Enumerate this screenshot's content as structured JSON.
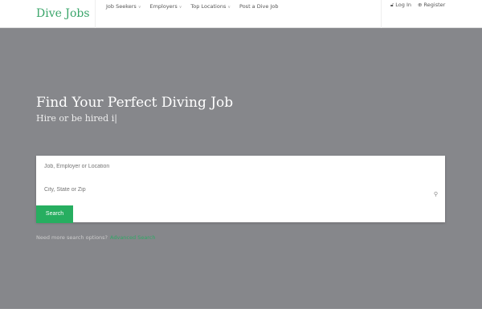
{
  "header": {
    "logo": "Dive Jobs",
    "nav": [
      {
        "label": "Job Seekers",
        "dropdown": true
      },
      {
        "label": "Employers",
        "dropdown": true
      },
      {
        "label": "Top Locations",
        "dropdown": true
      },
      {
        "label": "Post a Dive Job",
        "dropdown": false
      }
    ],
    "login": "Log In",
    "register": "Register"
  },
  "hero": {
    "title": "Find Your Perfect Diving Job",
    "subtitle": "Hire or be hired i|"
  },
  "search": {
    "keyword_placeholder": "Job, Employer or Location",
    "location_placeholder": "City, State or Zip",
    "button": "Search",
    "more_text": "Need more search options?",
    "more_link": "Advanced Search"
  },
  "colors": {
    "brand": "#27ae60",
    "hero_bg": "#86878b"
  }
}
